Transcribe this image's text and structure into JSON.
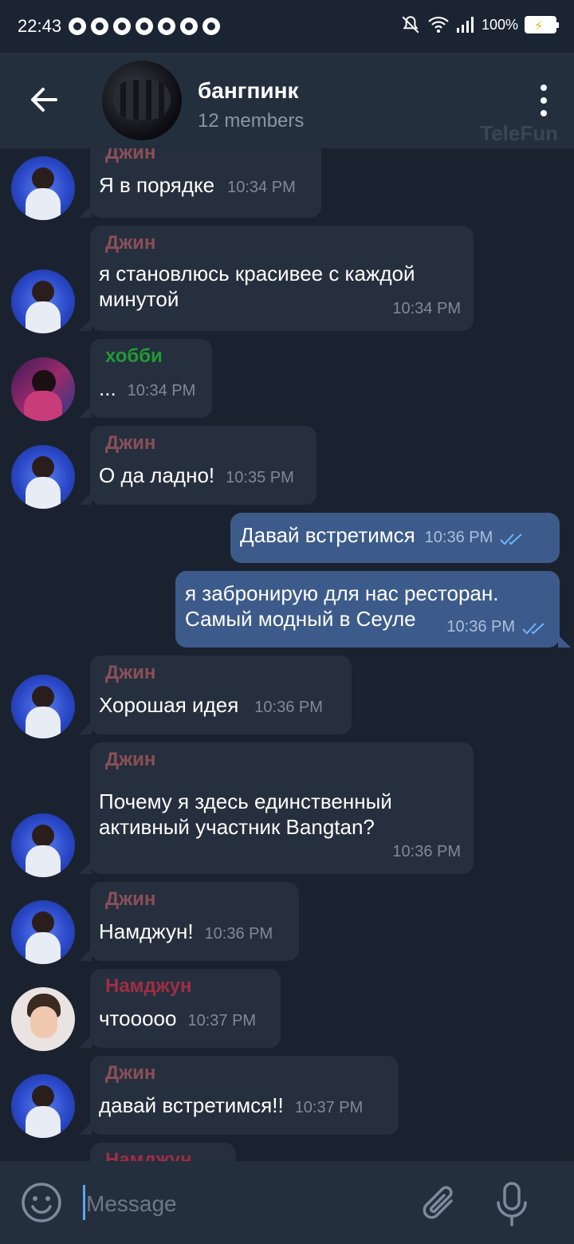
{
  "status_bar": {
    "time": "22:43",
    "battery": "100%",
    "icons": [
      "messenger-icon",
      "chrome-icon",
      "chrome-icon",
      "chrome-icon",
      "chrome-icon",
      "chrome-icon",
      "chrome-icon",
      "mute-icon",
      "wifi-icon",
      "signal-icon",
      "battery-icon"
    ]
  },
  "header": {
    "title": "бангпинк",
    "subtitle": "12 members",
    "watermark": "TeleFun"
  },
  "messages": [
    {
      "sender": "Джин",
      "text": "Я в порядке",
      "time": "10:34 PM"
    },
    {
      "sender": "Джин",
      "text": "я становлюсь красивее с каждой минутой",
      "time": "10:34 PM"
    },
    {
      "sender": "хобби",
      "text": "...",
      "time": "10:34 PM"
    },
    {
      "sender": "Джин",
      "text": "О да ладно!",
      "time": "10:35 PM"
    },
    {
      "sender": "",
      "text": "Давай встретимся",
      "time": "10:36 PM"
    },
    {
      "sender": "",
      "text": "я забронирую для нас ресторан. Самый модный в Сеуле",
      "time": "10:36 PM"
    },
    {
      "sender": "Джин",
      "text": "Хорошая идея",
      "time": "10:36 PM"
    },
    {
      "sender": "Джин",
      "text": "Почему я здесь единственный активный участник Bangtan?",
      "time": "10:36 PM"
    },
    {
      "sender": "Джин",
      "text": "Намджун!",
      "time": "10:36 PM"
    },
    {
      "sender": "Намджун",
      "text": "чтооооо",
      "time": "10:37 PM"
    },
    {
      "sender": "Джин",
      "text": "давай встретимся!!",
      "time": "10:37 PM"
    },
    {
      "sender": "Намджун",
      "text": "",
      "time": ""
    }
  ],
  "input": {
    "placeholder": "Message"
  },
  "colors": {
    "background": "#1a2230",
    "header": "#242f3e",
    "incoming_bubble": "#262f3d",
    "outgoing_bubble": "#3c5b8a",
    "name_jin": "#8a4f57",
    "name_hobi": "#1f9a35",
    "name_namjoon": "#a02d45",
    "accent": "#5ea5ee"
  }
}
